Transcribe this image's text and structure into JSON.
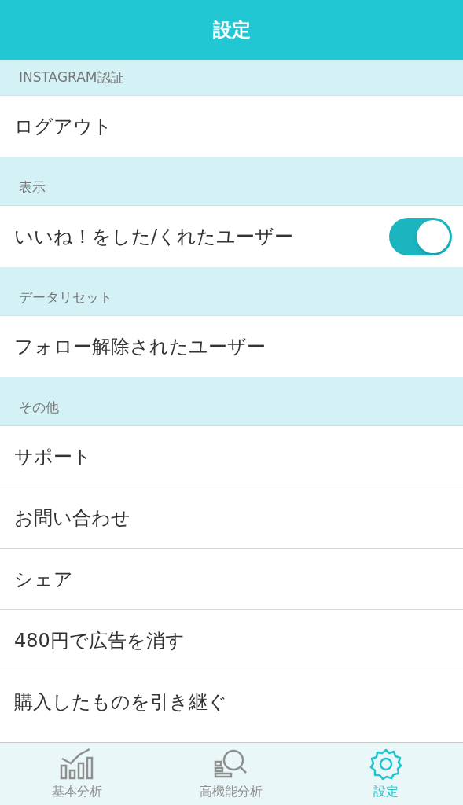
{
  "title": "設定",
  "sections": [
    {
      "header": "INSTAGRAM認証",
      "rows": [
        {
          "label": "ログアウト",
          "kind": "plain"
        }
      ]
    },
    {
      "header": "表示",
      "rows": [
        {
          "label": "いいね！をした/くれたユーザー",
          "kind": "toggle",
          "on": true
        }
      ]
    },
    {
      "header": "データリセット",
      "rows": [
        {
          "label": "フォロー解除されたユーザー",
          "kind": "plain"
        }
      ]
    },
    {
      "header": "その他",
      "rows": [
        {
          "label": "サポート",
          "kind": "plain"
        },
        {
          "label": "お問い合わせ",
          "kind": "plain"
        },
        {
          "label": "シェア",
          "kind": "plain"
        },
        {
          "label": "480円で広告を消す",
          "kind": "plain"
        },
        {
          "label": "購入したものを引き継ぐ",
          "kind": "plain"
        }
      ]
    }
  ],
  "tabs": [
    {
      "label": "基本分析",
      "selected": false,
      "kind": "basic"
    },
    {
      "label": "高機能分析",
      "selected": false,
      "kind": "advanced"
    },
    {
      "label": "設定",
      "selected": true,
      "kind": "settings"
    }
  ]
}
